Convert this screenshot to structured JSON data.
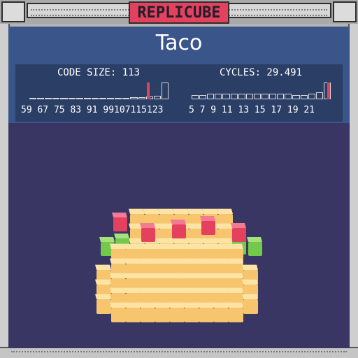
{
  "app": {
    "title": "REPLICUBE"
  },
  "level": {
    "name": "Taco"
  },
  "stats": {
    "code_size": {
      "label": "CODE SIZE: 113",
      "ticks": "59 67 75 83 91 99107115123",
      "histogram": [
        0.04,
        0.04,
        0.04,
        0.04,
        0.04,
        0.04,
        0.04,
        0.04,
        0.08,
        0.08,
        0.08,
        0.08,
        0.08,
        0.12,
        0.12,
        0.16,
        0.2,
        1.0
      ],
      "marker_fraction": 0.85
    },
    "cycles": {
      "label": "CYCLES: 29.491",
      "ticks": "5  7  9  11 13 15 17 19 21",
      "histogram": [
        0.25,
        0.25,
        0.35,
        0.35,
        0.35,
        0.35,
        0.35,
        0.35,
        0.35,
        0.35,
        0.35,
        0.35,
        0.35,
        0.25,
        0.25,
        0.35,
        0.4,
        1.0
      ],
      "marker_fraction": 0.98
    }
  },
  "colors": {
    "accent": "#e4415f",
    "cube": "#f4c36b",
    "lettuce": "#72c94a",
    "tomato": "#e4415f"
  }
}
